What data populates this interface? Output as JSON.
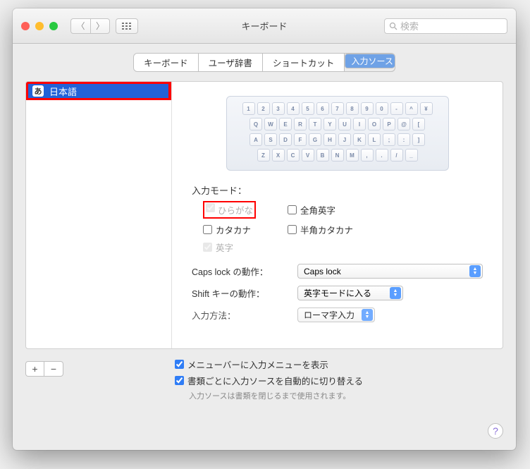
{
  "window": {
    "title": "キーボード"
  },
  "search": {
    "placeholder": "検索"
  },
  "tabs": {
    "items": [
      "キーボード",
      "ユーザ辞書",
      "ショートカット",
      "入力ソース"
    ],
    "selected": 3
  },
  "sidebar": {
    "items": [
      {
        "glyph": "あ",
        "label": "日本語"
      }
    ]
  },
  "keyboard_rows": [
    [
      "1",
      "2",
      "3",
      "4",
      "5",
      "6",
      "7",
      "8",
      "9",
      "0",
      "-",
      "^",
      "¥"
    ],
    [
      "Q",
      "W",
      "E",
      "R",
      "T",
      "Y",
      "U",
      "I",
      "O",
      "P",
      "@",
      "["
    ],
    [
      "A",
      "S",
      "D",
      "F",
      "G",
      "H",
      "J",
      "K",
      "L",
      ";",
      ":",
      "]"
    ],
    [
      "Z",
      "X",
      "C",
      "V",
      "B",
      "N",
      "M",
      ",",
      ".",
      "/",
      "_"
    ]
  ],
  "input_mode": {
    "label": "入力モード：",
    "hiragana": "ひらがな",
    "zenkaku_eiji": "全角英字",
    "katakana": "カタカナ",
    "hankaku_katakana": "半角カタカナ",
    "eiji": "英字"
  },
  "caps": {
    "label": "Caps lock の動作：",
    "value": "Caps lock"
  },
  "shift": {
    "label": "Shift キーの動作：",
    "value": "英字モードに入る"
  },
  "method": {
    "label": "入力方法：",
    "value": "ローマ字入力"
  },
  "bottom": {
    "opt1": "メニューバーに入力メニューを表示",
    "opt2": "書類ごとに入力ソースを自動的に切り替える",
    "hint": "入力ソースは書類を閉じるまで使用されます。"
  }
}
